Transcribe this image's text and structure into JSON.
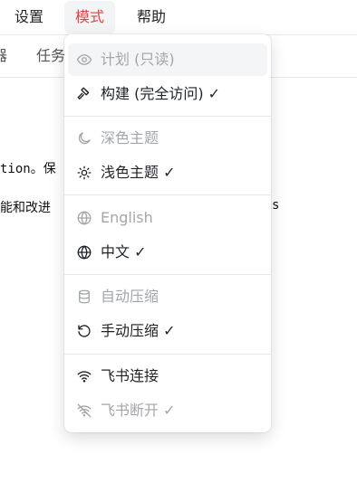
{
  "menubar": {
    "settings_label": "设置",
    "mode_label": "模式",
    "help_label": "帮助"
  },
  "toolbar": {
    "left_fragment": "器",
    "tab_label": "任务"
  },
  "content": {
    "line1": "tion。保",
    "line2": "能和改进",
    "line2_tail": "s"
  },
  "dropdown": {
    "items": [
      {
        "label": "计划 (只读)",
        "icon": "eye-icon",
        "state": "disabled"
      },
      {
        "label": "构建 (完全访问) ✓",
        "icon": "hammer-icon",
        "state": "enabled"
      },
      {
        "label": "深色主题",
        "icon": "moon-icon",
        "state": "disabled"
      },
      {
        "label": "浅色主题 ✓",
        "icon": "sun-icon",
        "state": "enabled"
      },
      {
        "label": "English",
        "icon": "globe-icon",
        "state": "disabled"
      },
      {
        "label": "中文 ✓",
        "icon": "globe-icon",
        "state": "enabled"
      },
      {
        "label": "自动压缩",
        "icon": "database-icon",
        "state": "disabled"
      },
      {
        "label": "手动压缩 ✓",
        "icon": "rotate-icon",
        "state": "enabled"
      },
      {
        "label": "飞书连接",
        "icon": "wifi-icon",
        "state": "enabled"
      },
      {
        "label": "飞书断开 ✓",
        "icon": "wifi-off-icon",
        "state": "disabled"
      }
    ]
  },
  "colors": {
    "accent": "#e0443e",
    "disabled_text": "#a2a6ab",
    "separator": "#e6e8eb"
  }
}
